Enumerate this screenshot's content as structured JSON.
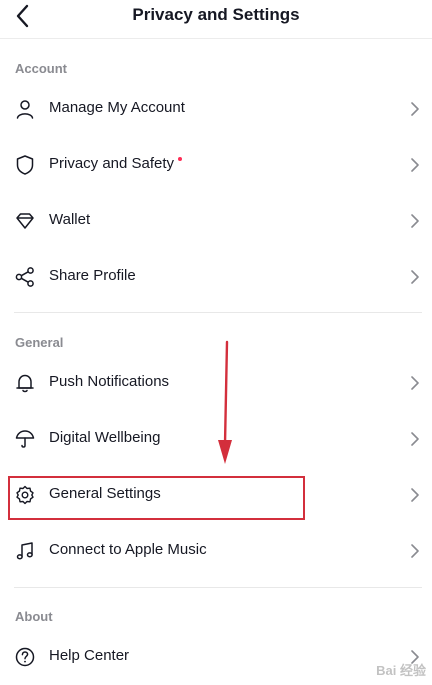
{
  "header": {
    "title": "Privacy and Settings"
  },
  "sections": {
    "account": {
      "title": "Account",
      "items": [
        {
          "label": "Manage My Account",
          "icon": "person-icon"
        },
        {
          "label": "Privacy and Safety",
          "icon": "shield-icon",
          "badge": "red-dot"
        },
        {
          "label": "Wallet",
          "icon": "diamond-icon"
        },
        {
          "label": "Share Profile",
          "icon": "share-icon"
        }
      ]
    },
    "general": {
      "title": "General",
      "items": [
        {
          "label": "Push Notifications",
          "icon": "bell-icon"
        },
        {
          "label": "Digital Wellbeing",
          "icon": "umbrella-icon"
        },
        {
          "label": "General Settings",
          "icon": "gear-icon"
        },
        {
          "label": "Connect to Apple Music",
          "icon": "music-note-icon"
        }
      ]
    },
    "about": {
      "title": "About",
      "items": [
        {
          "label": "Help Center",
          "icon": "question-circle-icon"
        }
      ]
    }
  },
  "annotation": {
    "highlight_color": "#d32f3c",
    "arrow_color": "#d32f3c"
  },
  "watermark": {
    "text": "Bai 经验"
  },
  "colors": {
    "text": "#161823",
    "section_title": "#8a8b91",
    "badge": "#fe2c55",
    "divider": "#e8e8e8"
  }
}
